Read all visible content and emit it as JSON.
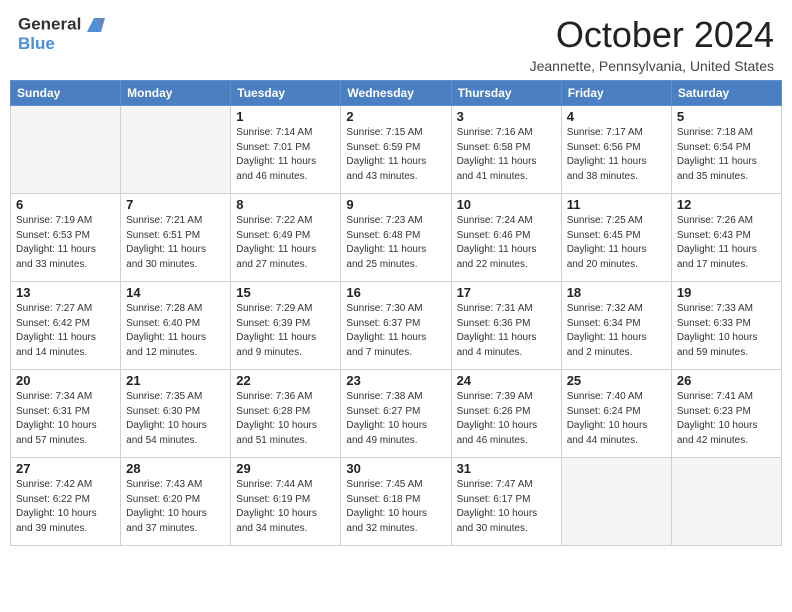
{
  "header": {
    "logo_line1": "General",
    "logo_line2": "Blue",
    "month_title": "October 2024",
    "location": "Jeannette, Pennsylvania, United States"
  },
  "days_of_week": [
    "Sunday",
    "Monday",
    "Tuesday",
    "Wednesday",
    "Thursday",
    "Friday",
    "Saturday"
  ],
  "weeks": [
    [
      {
        "day": "",
        "info": ""
      },
      {
        "day": "",
        "info": ""
      },
      {
        "day": "1",
        "info": "Sunrise: 7:14 AM\nSunset: 7:01 PM\nDaylight: 11 hours and 46 minutes."
      },
      {
        "day": "2",
        "info": "Sunrise: 7:15 AM\nSunset: 6:59 PM\nDaylight: 11 hours and 43 minutes."
      },
      {
        "day": "3",
        "info": "Sunrise: 7:16 AM\nSunset: 6:58 PM\nDaylight: 11 hours and 41 minutes."
      },
      {
        "day": "4",
        "info": "Sunrise: 7:17 AM\nSunset: 6:56 PM\nDaylight: 11 hours and 38 minutes."
      },
      {
        "day": "5",
        "info": "Sunrise: 7:18 AM\nSunset: 6:54 PM\nDaylight: 11 hours and 35 minutes."
      }
    ],
    [
      {
        "day": "6",
        "info": "Sunrise: 7:19 AM\nSunset: 6:53 PM\nDaylight: 11 hours and 33 minutes."
      },
      {
        "day": "7",
        "info": "Sunrise: 7:21 AM\nSunset: 6:51 PM\nDaylight: 11 hours and 30 minutes."
      },
      {
        "day": "8",
        "info": "Sunrise: 7:22 AM\nSunset: 6:49 PM\nDaylight: 11 hours and 27 minutes."
      },
      {
        "day": "9",
        "info": "Sunrise: 7:23 AM\nSunset: 6:48 PM\nDaylight: 11 hours and 25 minutes."
      },
      {
        "day": "10",
        "info": "Sunrise: 7:24 AM\nSunset: 6:46 PM\nDaylight: 11 hours and 22 minutes."
      },
      {
        "day": "11",
        "info": "Sunrise: 7:25 AM\nSunset: 6:45 PM\nDaylight: 11 hours and 20 minutes."
      },
      {
        "day": "12",
        "info": "Sunrise: 7:26 AM\nSunset: 6:43 PM\nDaylight: 11 hours and 17 minutes."
      }
    ],
    [
      {
        "day": "13",
        "info": "Sunrise: 7:27 AM\nSunset: 6:42 PM\nDaylight: 11 hours and 14 minutes."
      },
      {
        "day": "14",
        "info": "Sunrise: 7:28 AM\nSunset: 6:40 PM\nDaylight: 11 hours and 12 minutes."
      },
      {
        "day": "15",
        "info": "Sunrise: 7:29 AM\nSunset: 6:39 PM\nDaylight: 11 hours and 9 minutes."
      },
      {
        "day": "16",
        "info": "Sunrise: 7:30 AM\nSunset: 6:37 PM\nDaylight: 11 hours and 7 minutes."
      },
      {
        "day": "17",
        "info": "Sunrise: 7:31 AM\nSunset: 6:36 PM\nDaylight: 11 hours and 4 minutes."
      },
      {
        "day": "18",
        "info": "Sunrise: 7:32 AM\nSunset: 6:34 PM\nDaylight: 11 hours and 2 minutes."
      },
      {
        "day": "19",
        "info": "Sunrise: 7:33 AM\nSunset: 6:33 PM\nDaylight: 10 hours and 59 minutes."
      }
    ],
    [
      {
        "day": "20",
        "info": "Sunrise: 7:34 AM\nSunset: 6:31 PM\nDaylight: 10 hours and 57 minutes."
      },
      {
        "day": "21",
        "info": "Sunrise: 7:35 AM\nSunset: 6:30 PM\nDaylight: 10 hours and 54 minutes."
      },
      {
        "day": "22",
        "info": "Sunrise: 7:36 AM\nSunset: 6:28 PM\nDaylight: 10 hours and 51 minutes."
      },
      {
        "day": "23",
        "info": "Sunrise: 7:38 AM\nSunset: 6:27 PM\nDaylight: 10 hours and 49 minutes."
      },
      {
        "day": "24",
        "info": "Sunrise: 7:39 AM\nSunset: 6:26 PM\nDaylight: 10 hours and 46 minutes."
      },
      {
        "day": "25",
        "info": "Sunrise: 7:40 AM\nSunset: 6:24 PM\nDaylight: 10 hours and 44 minutes."
      },
      {
        "day": "26",
        "info": "Sunrise: 7:41 AM\nSunset: 6:23 PM\nDaylight: 10 hours and 42 minutes."
      }
    ],
    [
      {
        "day": "27",
        "info": "Sunrise: 7:42 AM\nSunset: 6:22 PM\nDaylight: 10 hours and 39 minutes."
      },
      {
        "day": "28",
        "info": "Sunrise: 7:43 AM\nSunset: 6:20 PM\nDaylight: 10 hours and 37 minutes."
      },
      {
        "day": "29",
        "info": "Sunrise: 7:44 AM\nSunset: 6:19 PM\nDaylight: 10 hours and 34 minutes."
      },
      {
        "day": "30",
        "info": "Sunrise: 7:45 AM\nSunset: 6:18 PM\nDaylight: 10 hours and 32 minutes."
      },
      {
        "day": "31",
        "info": "Sunrise: 7:47 AM\nSunset: 6:17 PM\nDaylight: 10 hours and 30 minutes."
      },
      {
        "day": "",
        "info": ""
      },
      {
        "day": "",
        "info": ""
      }
    ]
  ]
}
